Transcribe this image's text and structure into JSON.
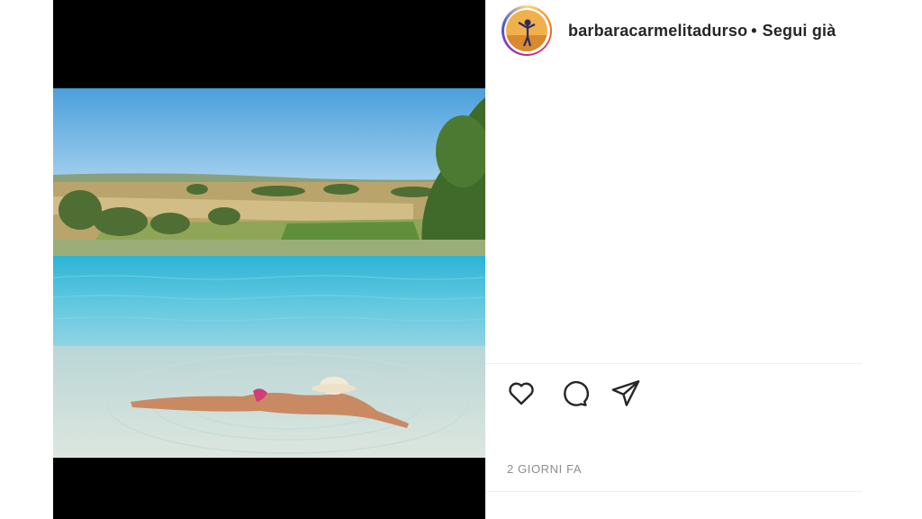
{
  "post": {
    "username": "barbaracarmelitadurso",
    "separator": "•",
    "follow_status": "Segui già",
    "timestamp": "2 GIORNI FA"
  },
  "actions": [
    {
      "icon": "heart-icon"
    },
    {
      "icon": "comment-icon"
    },
    {
      "icon": "share-icon"
    }
  ],
  "colors": {
    "text_primary": "#262626",
    "text_secondary": "#8e8e8e",
    "divider": "#efefef",
    "media_background": "#000000"
  }
}
